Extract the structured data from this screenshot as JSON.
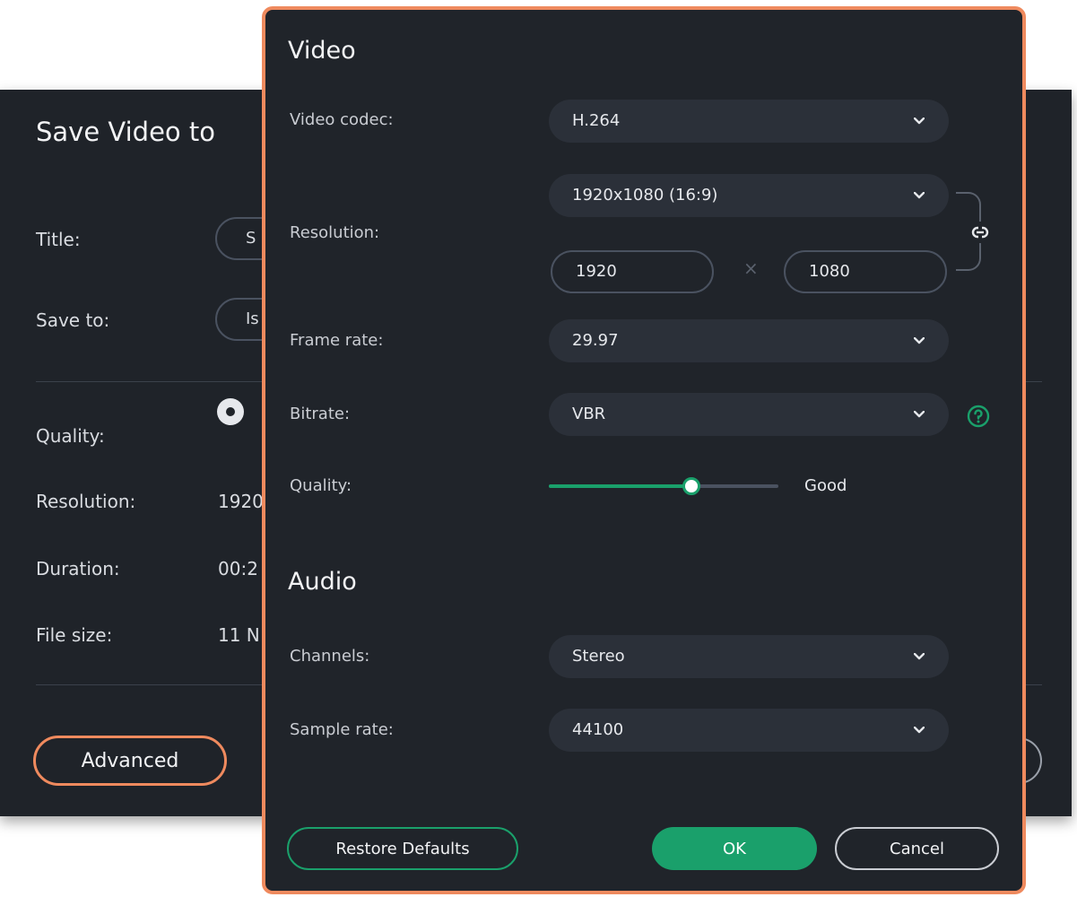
{
  "background_dialog": {
    "title": "Save Video to",
    "title_label": "Title:",
    "title_value": "S",
    "save_to_label": "Save to:",
    "save_to_value": "Is",
    "quality_label": "Quality:",
    "resolution_label": "Resolution:",
    "resolution_value": "1920",
    "duration_label": "Duration:",
    "duration_value": "00:2",
    "file_size_label": "File size:",
    "file_size_value": "11 N",
    "advanced_label": "Advanced"
  },
  "settings": {
    "video_section": "Video",
    "video_codec_label": "Video codec:",
    "video_codec_value": "H.264",
    "resolution_label": "Resolution:",
    "resolution_preset": "1920x1080 (16:9)",
    "width_value": "1920",
    "height_value": "1080",
    "times_symbol": "×",
    "frame_rate_label": "Frame rate:",
    "frame_rate_value": "29.97",
    "bitrate_label": "Bitrate:",
    "bitrate_value": "VBR",
    "quality_label": "Quality:",
    "quality_level": 0.62,
    "quality_value": "Good",
    "audio_section": "Audio",
    "channels_label": "Channels:",
    "channels_value": "Stereo",
    "sample_rate_label": "Sample rate:",
    "sample_rate_value": "44100",
    "restore_defaults_label": "Restore Defaults",
    "ok_label": "OK",
    "cancel_label": "Cancel"
  },
  "colors": {
    "dialog_bg": "#20242a",
    "accent_green": "#1aa06b",
    "highlight_orange": "#ef8a5e"
  },
  "icons": {
    "chevron": "chevron-down-icon",
    "link": "link-icon",
    "help": "help-icon"
  }
}
